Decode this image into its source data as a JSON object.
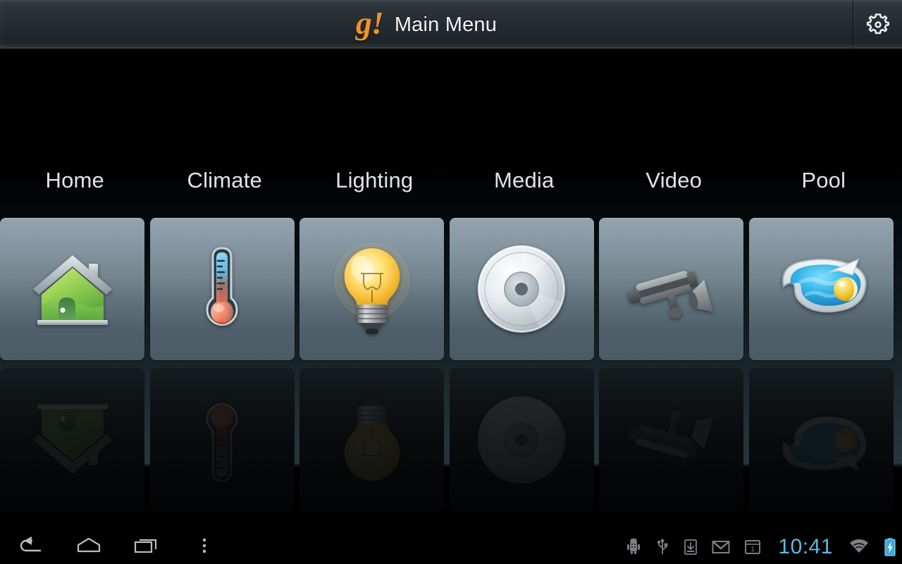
{
  "header": {
    "brand_logo": "g!",
    "title": "Main Menu",
    "settings_icon": "gear-icon",
    "accent_color": "#f0922b"
  },
  "menu": {
    "items": [
      {
        "label": "Home",
        "icon": "house-icon"
      },
      {
        "label": "Climate",
        "icon": "thermometer-icon"
      },
      {
        "label": "Lighting",
        "icon": "lightbulb-icon"
      },
      {
        "label": "Media",
        "icon": "disc-icon"
      },
      {
        "label": "Video",
        "icon": "security-camera-icon"
      },
      {
        "label": "Pool",
        "icon": "swimming-pool-icon"
      }
    ]
  },
  "navbar": {
    "buttons": [
      {
        "name": "back-button",
        "icon": "back-arrow-icon"
      },
      {
        "name": "home-button",
        "icon": "home-icon"
      },
      {
        "name": "recent-apps-button",
        "icon": "recent-apps-icon"
      },
      {
        "name": "overflow-menu-button",
        "icon": "overflow-dots-icon"
      }
    ],
    "status": {
      "icons": [
        {
          "name": "android-debug-icon"
        },
        {
          "name": "usb-icon"
        },
        {
          "name": "download-icon"
        },
        {
          "name": "gmail-icon"
        },
        {
          "name": "calendar-icon",
          "value": "1"
        },
        {
          "name": "wifi-icon"
        },
        {
          "name": "battery-charging-icon"
        }
      ],
      "clock": "10:41",
      "clock_color": "#5fb9e0"
    }
  }
}
